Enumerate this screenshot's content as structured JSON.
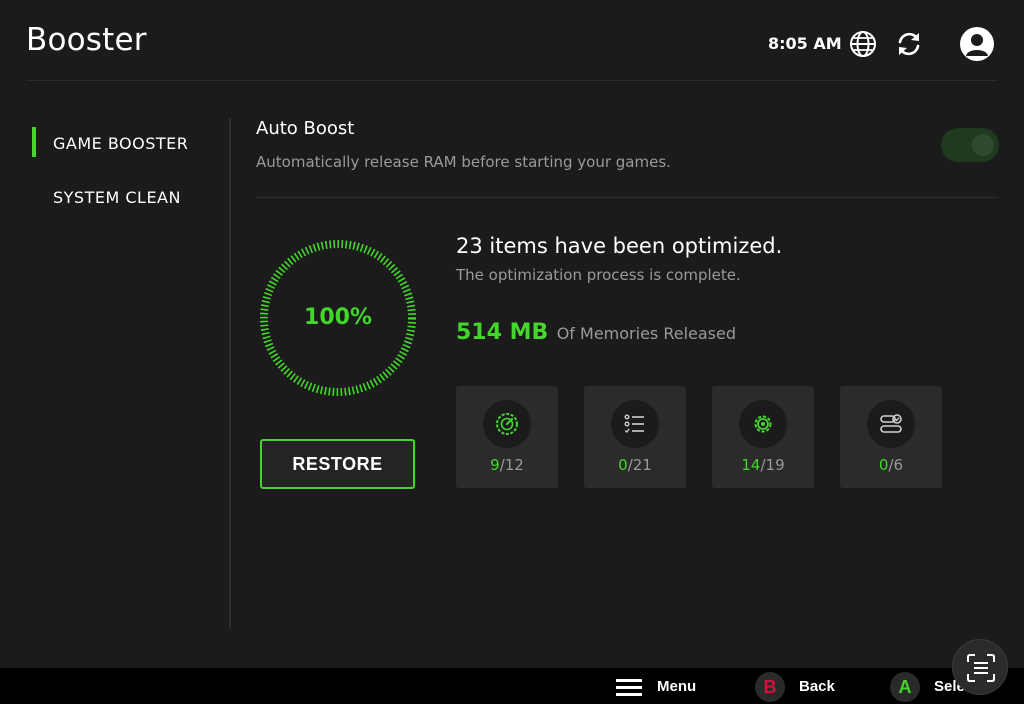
{
  "header": {
    "title": "Booster",
    "time": "8:05 AM",
    "icons": [
      "globe-icon",
      "sync-icon",
      "avatar"
    ]
  },
  "sidebar": {
    "items": [
      {
        "label": "GAME BOOSTER",
        "active": true
      },
      {
        "label": "SYSTEM CLEAN",
        "active": false
      }
    ]
  },
  "auto_boost": {
    "title": "Auto Boost",
    "description": "Automatically release RAM before starting your games.",
    "enabled": true
  },
  "optimization": {
    "progress_label": "100%",
    "progress": 100,
    "title": "23 items have been optimized.",
    "subtitle": "The optimization process is complete.",
    "memory_value": "514 MB",
    "memory_label": "Of Memories Released",
    "restore_label": "RESTORE"
  },
  "stats": [
    {
      "icon": "speedometer-icon",
      "count": "9",
      "total": "/12"
    },
    {
      "icon": "checklist-icon",
      "count": "0",
      "total": "/21"
    },
    {
      "icon": "gear-icon",
      "count": "14",
      "total": "/19"
    },
    {
      "icon": "toggle-settings-icon",
      "count": "0",
      "total": "/6"
    }
  ],
  "footer": {
    "menu_label": "Menu",
    "back_key": "B",
    "back_label": "Back",
    "select_key": "A",
    "select_label": "Select"
  },
  "colors": {
    "accent": "#44d62c",
    "background": "#1b1b1b",
    "card": "#2b2b2b",
    "back_button": "#d4113a"
  }
}
